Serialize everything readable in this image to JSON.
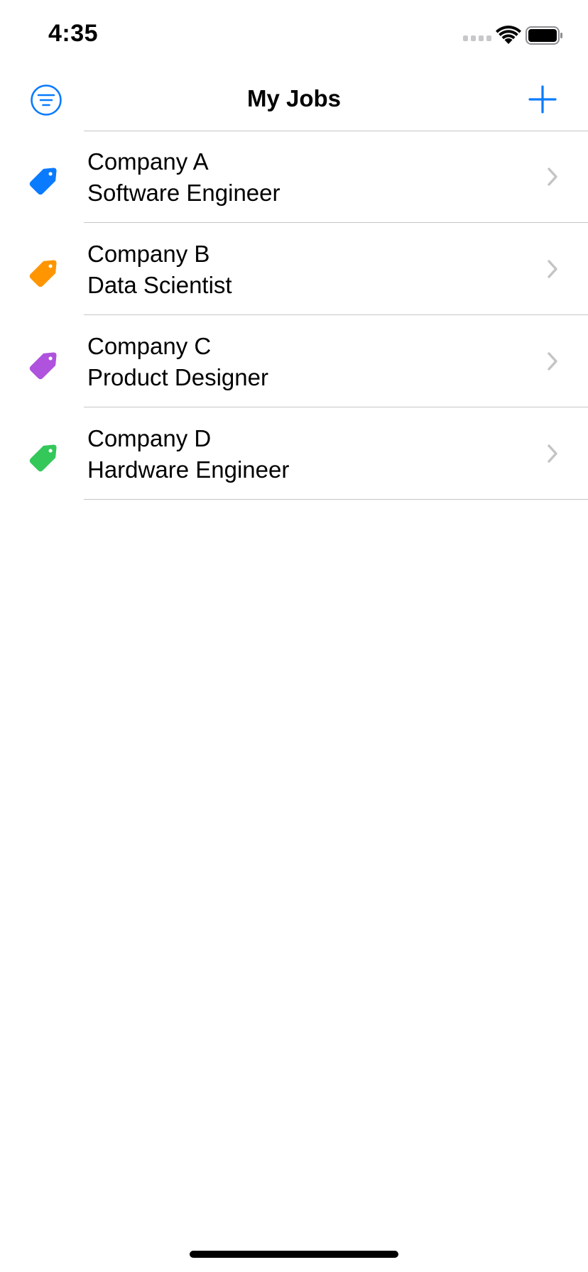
{
  "status_bar": {
    "time": "4:35",
    "icons": [
      "cellular-signal-icon",
      "wifi-icon",
      "battery-icon"
    ]
  },
  "nav": {
    "title": "My Jobs",
    "left_icon": "filter-icon",
    "right_icon": "plus-icon",
    "accent_color": "#0a7aff"
  },
  "jobs": [
    {
      "company": "Company A",
      "role": "Software Engineer",
      "tag_color": "#0a7aff",
      "icon": "tag-icon"
    },
    {
      "company": "Company B",
      "role": "Data Scientist",
      "tag_color": "#ff9500",
      "icon": "tag-icon"
    },
    {
      "company": "Company C",
      "role": "Product Designer",
      "tag_color": "#af52de",
      "icon": "tag-icon"
    },
    {
      "company": "Company D",
      "role": "Hardware Engineer",
      "tag_color": "#34c759",
      "icon": "tag-icon"
    }
  ]
}
